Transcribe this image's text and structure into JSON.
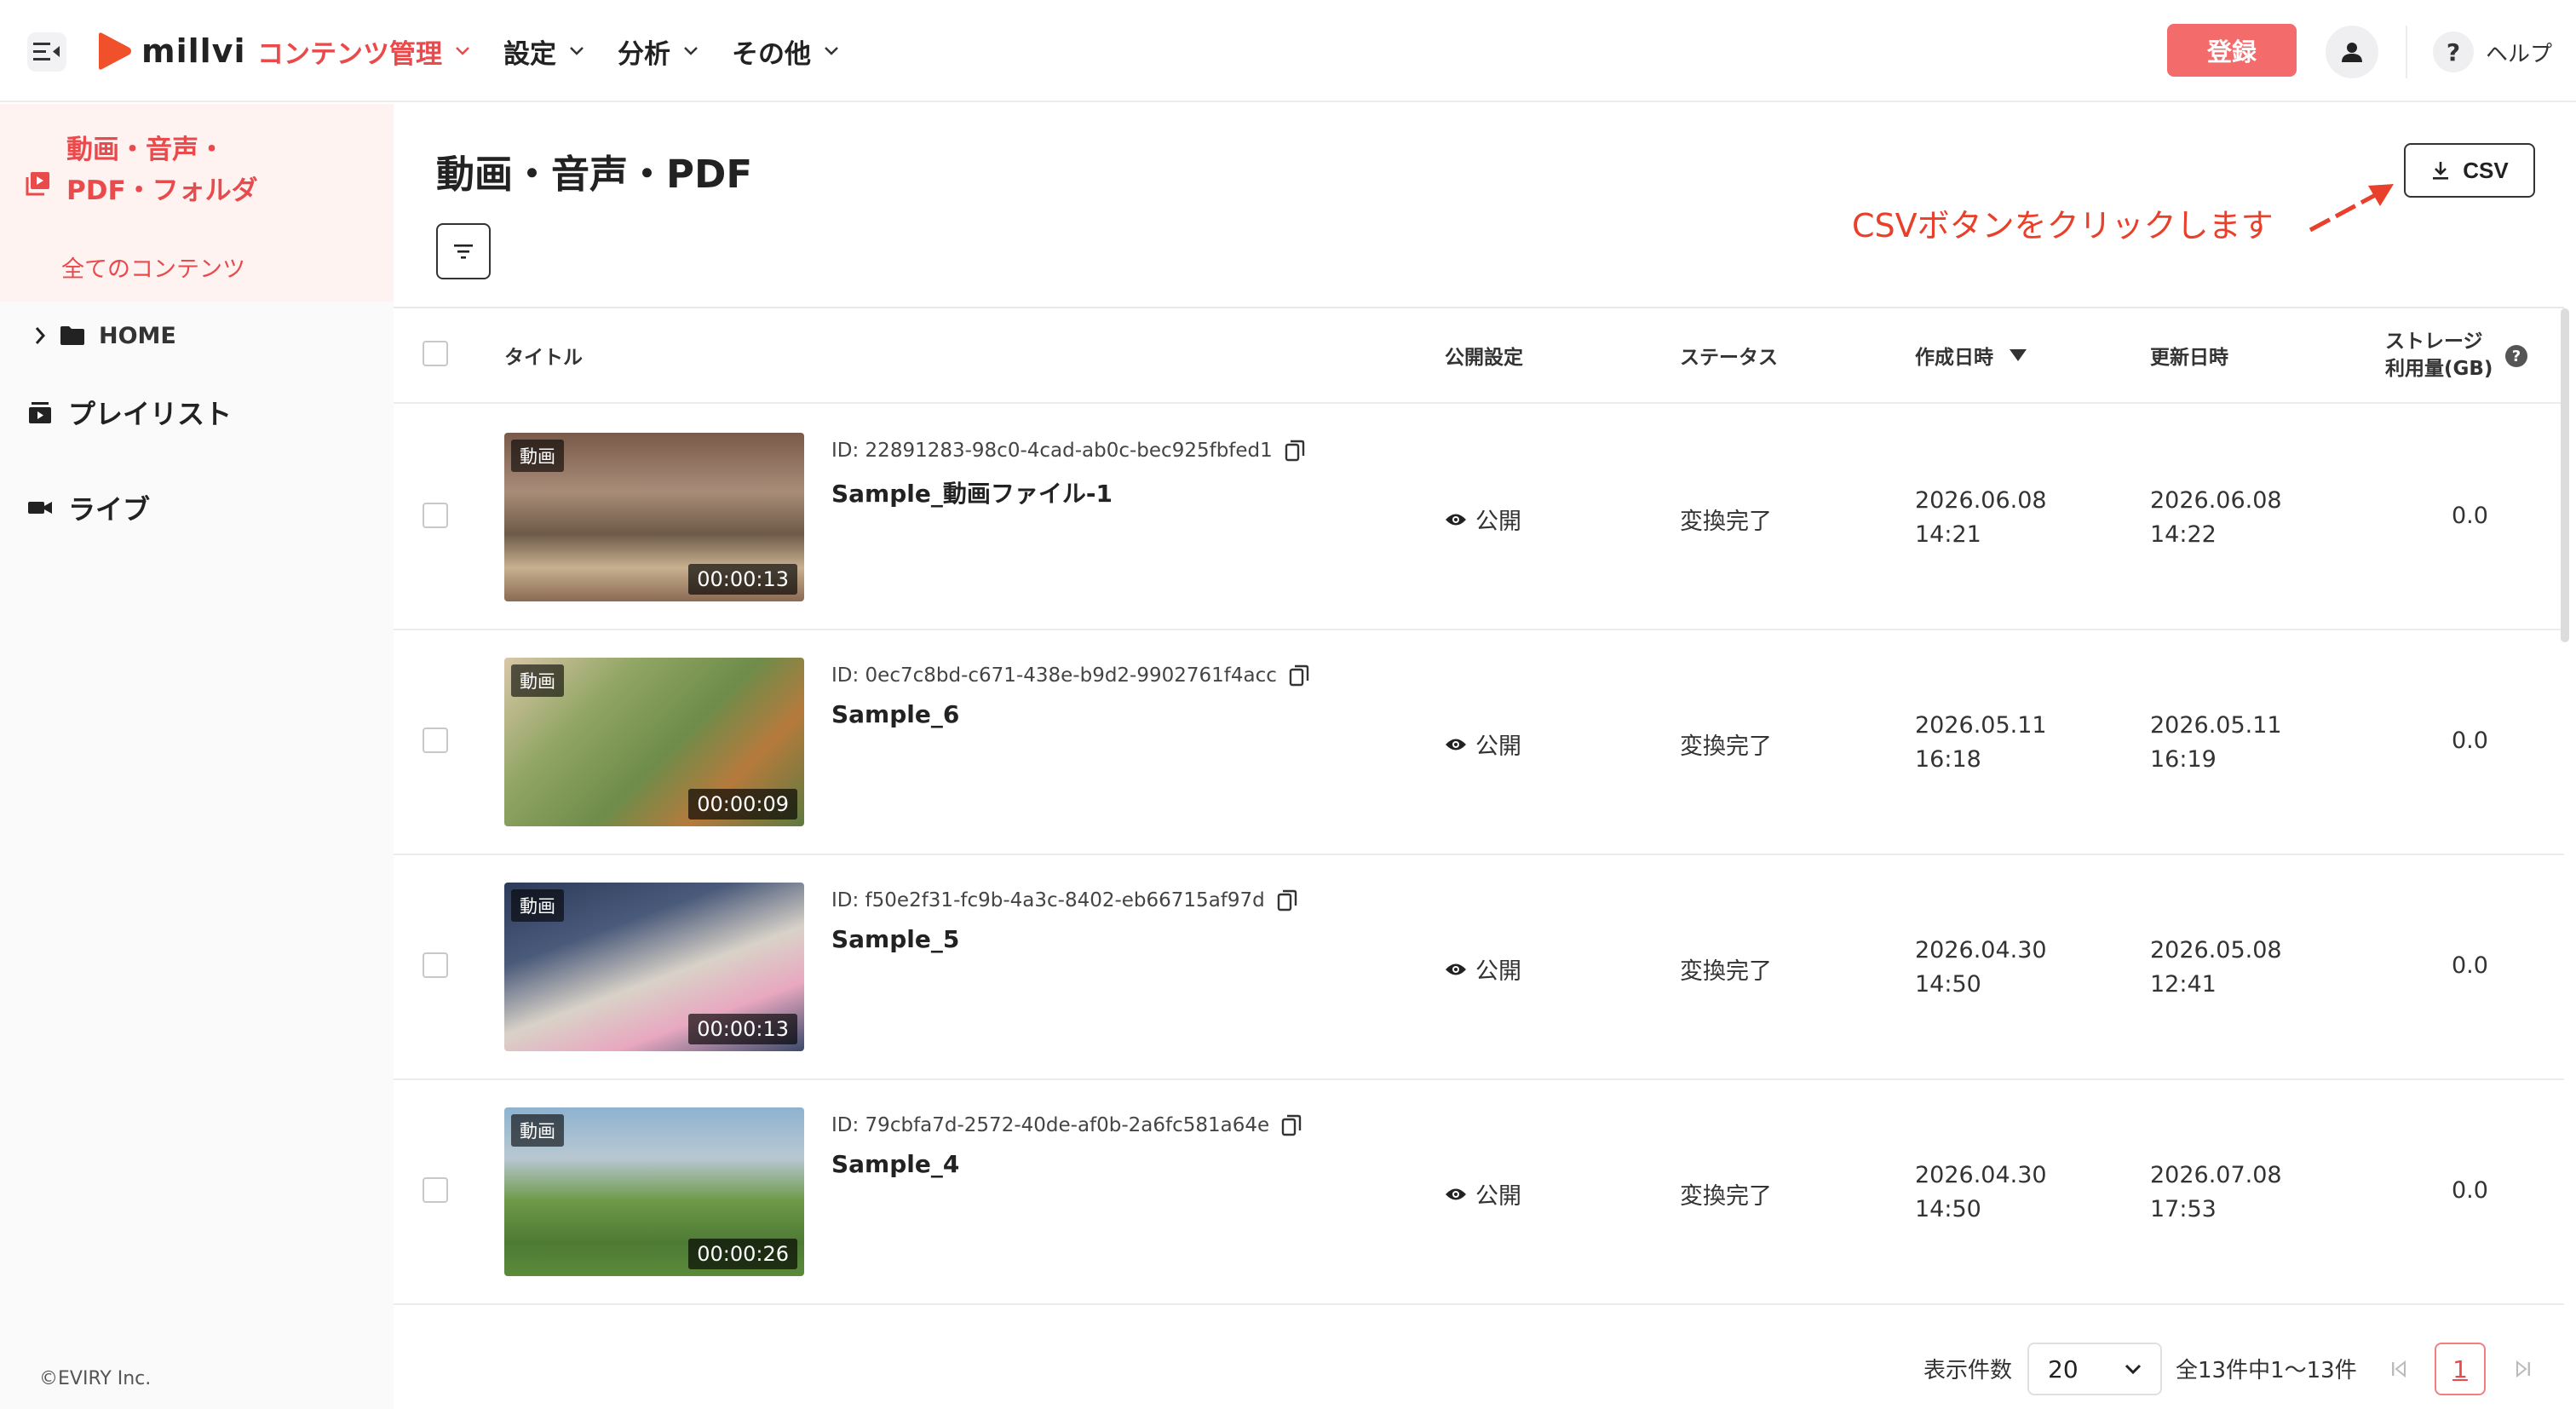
{
  "header": {
    "logo_text": "millvi",
    "nav": [
      {
        "label": "コンテンツ管理",
        "active": true
      },
      {
        "label": "設定",
        "active": false
      },
      {
        "label": "分析",
        "active": false
      },
      {
        "label": "その他",
        "active": false
      }
    ],
    "register_label": "登録",
    "help_label": "ヘルプ",
    "help_glyph": "?"
  },
  "sidebar": {
    "main_label": "動画・音声・PDF・フォルダ",
    "sub_label": "全てのコンテンツ",
    "home_label": "HOME",
    "playlist_label": "プレイリスト",
    "live_label": "ライブ",
    "copyright": "©EVIRY Inc."
  },
  "main": {
    "title": "動画・音声・PDF",
    "csv_label": "CSV",
    "annotation": "CSVボタンをクリックします"
  },
  "table": {
    "headers": {
      "title": "タイトル",
      "visibility": "公開設定",
      "status": "ステータス",
      "created": "作成日時",
      "updated": "更新日時",
      "storage_line1": "ストレージ",
      "storage_line2": "利用量(GB)"
    },
    "rows": [
      {
        "tag": "動画",
        "duration": "00:00:13",
        "id": "ID: 22891283-98c0-4cad-ab0c-bec925fbfed1",
        "name": "Sample_動画ファイル-1",
        "visibility": "公開",
        "status": "変換完了",
        "created_date": "2026.06.08",
        "created_time": "14:21",
        "updated_date": "2026.06.08",
        "updated_time": "14:22",
        "storage": "0.0"
      },
      {
        "tag": "動画",
        "duration": "00:00:09",
        "id": "ID: 0ec7c8bd-c671-438e-b9d2-9902761f4acc",
        "name": "Sample_6",
        "visibility": "公開",
        "status": "変換完了",
        "created_date": "2026.05.11",
        "created_time": "16:18",
        "updated_date": "2026.05.11",
        "updated_time": "16:19",
        "storage": "0.0"
      },
      {
        "tag": "動画",
        "duration": "00:00:13",
        "id": "ID: f50e2f31-fc9b-4a3c-8402-eb66715af97d",
        "name": "Sample_5",
        "visibility": "公開",
        "status": "変換完了",
        "created_date": "2026.04.30",
        "created_time": "14:50",
        "updated_date": "2026.05.08",
        "updated_time": "12:41",
        "storage": "0.0"
      },
      {
        "tag": "動画",
        "duration": "00:00:26",
        "id": "ID: 79cbfa7d-2572-40de-af0b-2a6fc581a64e",
        "name": "Sample_4",
        "visibility": "公開",
        "status": "変換完了",
        "created_date": "2026.04.30",
        "created_time": "14:50",
        "updated_date": "2026.07.08",
        "updated_time": "17:53",
        "storage": "0.0"
      }
    ]
  },
  "pagination": {
    "per_page_label": "表示件数",
    "per_page_value": "20",
    "range_text": "全13件中1〜13件",
    "current_page": "1"
  },
  "colors": {
    "accent": "#e94a4c",
    "register_bg": "#f36b6b",
    "sidebar_active_bg": "#fff3f2",
    "annotation": "#e8402a"
  }
}
